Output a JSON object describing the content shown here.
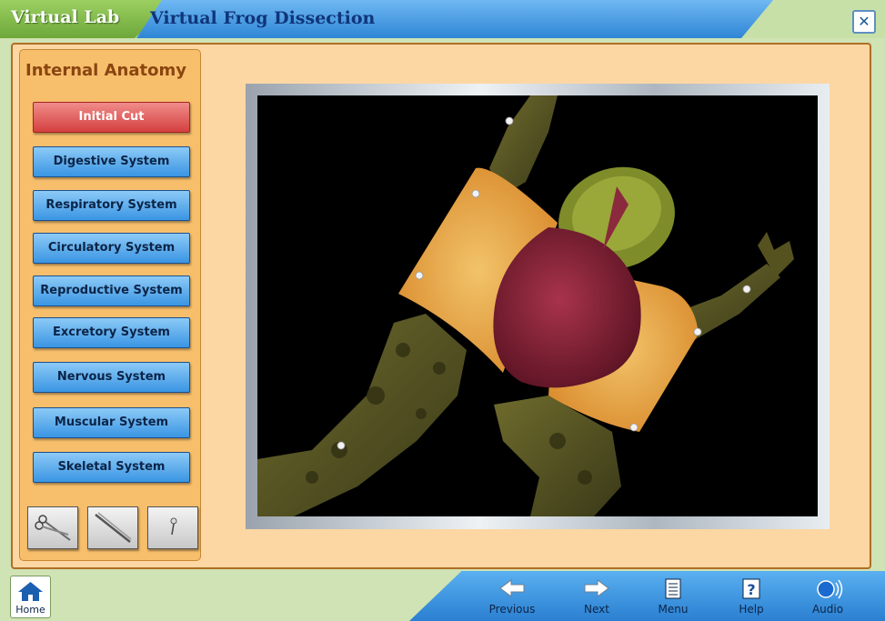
{
  "header": {
    "brand": "Virtual Lab",
    "title": "Virtual Frog Dissection",
    "close_label": "x"
  },
  "sidebar": {
    "title": "Internal Anatomy",
    "buttons": [
      {
        "label": "Initial Cut",
        "active": true
      },
      {
        "label": "Digestive System"
      },
      {
        "label": "Respiratory System"
      },
      {
        "label": "Circulatory System"
      },
      {
        "label": "Reproductive System"
      },
      {
        "label": "Excretory System"
      },
      {
        "label": "Nervous System"
      },
      {
        "label": "Muscular System"
      },
      {
        "label": "Skeletal System"
      }
    ],
    "tools": [
      "scissors-icon",
      "forceps-icon",
      "pin-icon"
    ]
  },
  "footer": {
    "home": "Home",
    "previous": "Previous",
    "next": "Next",
    "menu": "Menu",
    "help": "Help",
    "audio": "Audio"
  },
  "colors": {
    "header_blue": "#2f86d6",
    "brand_green": "#6ea83a",
    "panel_orange": "#fcd7a3",
    "nav_blue": "#3a95e3",
    "active_red": "#d4403f"
  }
}
